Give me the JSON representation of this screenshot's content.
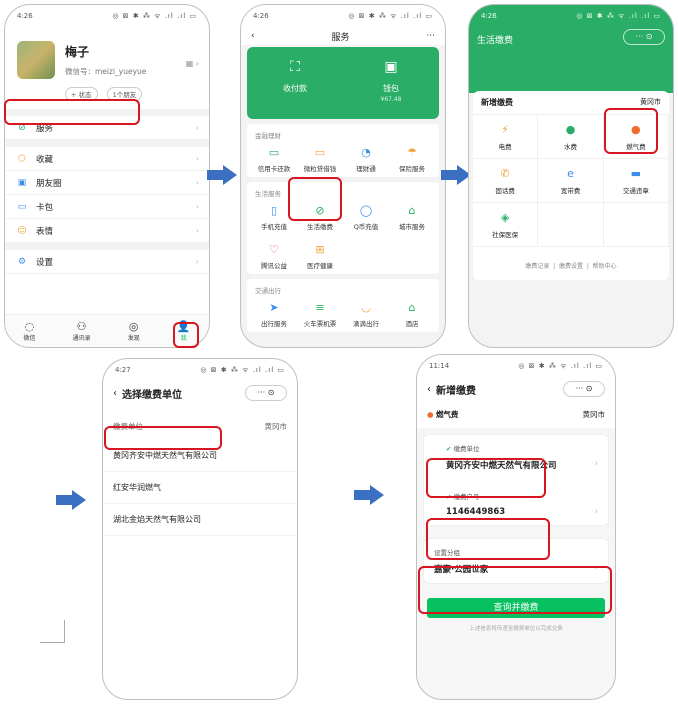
{
  "status": {
    "carrier1": "中国移动",
    "carrier2": "中国电信",
    "time1": "4:26",
    "time2": "4:27",
    "time3": "11:14",
    "icons": "◎ ⊠ ✱ ⁂ ᯤ .ıl .ıl ▭"
  },
  "phone1": {
    "name": "梅子",
    "wechat_id": "微信号：meizi_yueyue",
    "status_pill": "+ 状态",
    "friends_pill": "1个朋友",
    "menu": [
      {
        "icon": "service-icon",
        "glyph": "⊘",
        "label": "服务",
        "color": "#2aae67"
      },
      {
        "icon": "favorites-icon",
        "glyph": "⬡",
        "label": "收藏",
        "color": "#f0a13a"
      },
      {
        "icon": "moments-icon",
        "glyph": "▣",
        "label": "朋友圈",
        "color": "#3d8ee8"
      },
      {
        "icon": "cards-icon",
        "glyph": "▭",
        "label": "卡包",
        "color": "#3d8ee8"
      },
      {
        "icon": "emoji-icon",
        "glyph": "☺",
        "label": "表情",
        "color": "#f0a13a"
      },
      {
        "icon": "settings-icon",
        "glyph": "⚙",
        "label": "设置",
        "color": "#3d8ee8"
      }
    ],
    "tabs": [
      {
        "label": "微信",
        "glyph": "◌",
        "badge": "2"
      },
      {
        "label": "通讯录",
        "glyph": "⚇",
        "badge": ""
      },
      {
        "label": "发现",
        "glyph": "◎",
        "badge": "1"
      },
      {
        "label": "我",
        "glyph": "👤",
        "badge": ""
      }
    ]
  },
  "phone2": {
    "title": "服务",
    "pay_label": "收付款",
    "wallet_label": "钱包",
    "wallet_amount": "¥67.48",
    "sections": [
      {
        "title": "金融理财",
        "items": [
          {
            "icon": "credit-card-icon",
            "glyph": "▭",
            "label": "信用卡还款",
            "color": "#2aae67"
          },
          {
            "icon": "loan-icon",
            "glyph": "▭",
            "label": "微粒贷借钱",
            "color": "#f0a13a"
          },
          {
            "icon": "wealth-icon",
            "glyph": "◔",
            "label": "理财通",
            "color": "#3d8ee8"
          },
          {
            "icon": "insurance-icon",
            "glyph": "☂",
            "label": "保险服务",
            "color": "#f0a13a"
          }
        ]
      },
      {
        "title": "生活服务",
        "items": [
          {
            "icon": "phone-recharge-icon",
            "glyph": "▯",
            "label": "手机充值",
            "color": "#3d8ee8"
          },
          {
            "icon": "utility-pay-icon",
            "glyph": "⊘",
            "label": "生活缴费",
            "color": "#2aae67"
          },
          {
            "icon": "qcoin-icon",
            "glyph": "◯",
            "label": "Q币充值",
            "color": "#3d8ee8"
          },
          {
            "icon": "city-service-icon",
            "glyph": "⌂",
            "label": "城市服务",
            "color": "#2aae67"
          },
          {
            "icon": "charity-icon",
            "glyph": "♡",
            "label": "腾讯公益",
            "color": "#e84b4b"
          },
          {
            "icon": "medical-icon",
            "glyph": "⊞",
            "label": "医疗健康",
            "color": "#f0a13a"
          }
        ]
      },
      {
        "title": "交通出行",
        "items": [
          {
            "icon": "travel-icon",
            "glyph": "➤",
            "label": "出行服务",
            "color": "#3d8ee8"
          },
          {
            "icon": "train-ticket-icon",
            "glyph": "≡",
            "label": "火车票机票",
            "color": "#2aae67"
          },
          {
            "icon": "didi-icon",
            "glyph": "◡",
            "label": "滴滴出行",
            "color": "#f0a13a"
          },
          {
            "icon": "hotel-icon",
            "glyph": "⌂",
            "label": "酒店",
            "color": "#2aae67"
          }
        ]
      }
    ]
  },
  "phone3": {
    "title": "生活缴费",
    "card_title": "新增缴费",
    "city": "黄冈市",
    "items": [
      {
        "icon": "electricity-icon",
        "glyph": "⚡",
        "label": "电费",
        "color": "#f0a13a"
      },
      {
        "icon": "water-icon",
        "glyph": "💧",
        "label": "水费",
        "color": "#2aae67"
      },
      {
        "icon": "gas-icon",
        "glyph": "🔥",
        "label": "燃气费",
        "color": "#f06b2e"
      },
      {
        "icon": "landline-icon",
        "glyph": "✆",
        "label": "固话费",
        "color": "#f0a13a"
      },
      {
        "icon": "broadband-icon",
        "glyph": "e",
        "label": "宽带费",
        "color": "#3d8ee8"
      },
      {
        "icon": "traffic-fine-icon",
        "glyph": "▬",
        "label": "交通违章",
        "color": "#3d8ee8"
      },
      {
        "icon": "social-insurance-icon",
        "glyph": "◈",
        "label": "社保医保",
        "color": "#2aae67"
      }
    ],
    "links": [
      "缴费记录",
      "缴费设置",
      "帮助中心"
    ]
  },
  "phone4": {
    "title": "选择缴费单位",
    "header_label": "缴费单位",
    "city": "黄冈市",
    "options": [
      "黄冈齐安中燃天然气有限公司",
      "红安华润燃气",
      "湖北金焰天然气有限公司"
    ]
  },
  "phone5": {
    "title": "新增缴费",
    "category": "燃气费",
    "city": "黄冈市",
    "unit_label": "缴费单位",
    "unit_value": "黄冈齐安中燃天然气有限公司",
    "account_label": "缴费户号",
    "account_value": "1146449863",
    "group_label": "设置分组",
    "group_value": "嘉豪·公园世家",
    "submit": "查询并缴费",
    "note": "上述信息将传递至缴费单位以完成交费"
  }
}
